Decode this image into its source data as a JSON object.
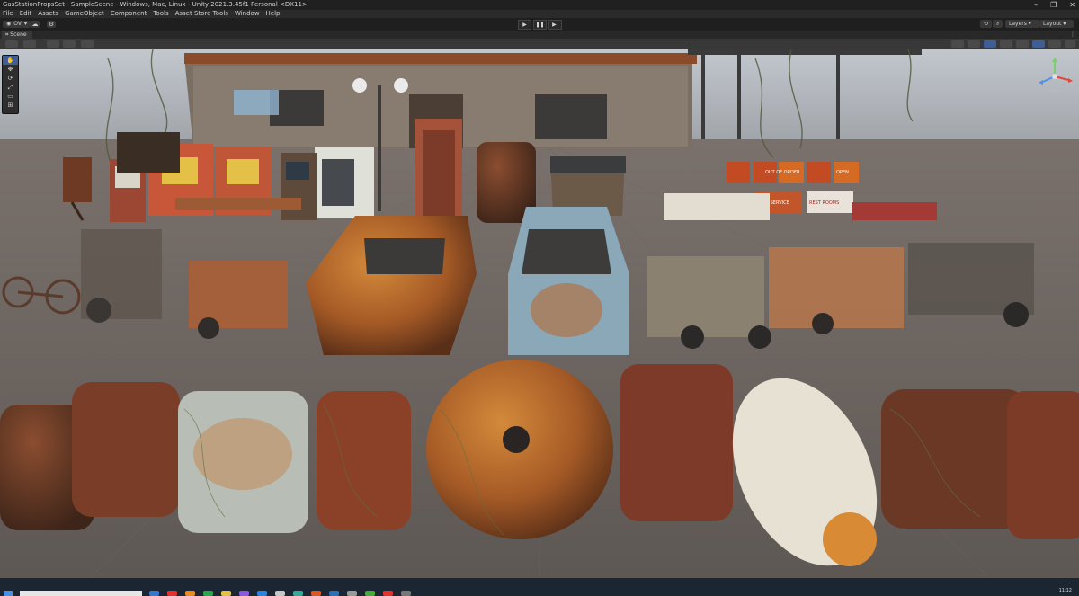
{
  "window": {
    "title": "GasStationPropsSet - SampleScene - Windows, Mac, Linux - Unity 2021.3.45f1 Personal <DX11>"
  },
  "menu": [
    "File",
    "Edit",
    "Assets",
    "GameObject",
    "Component",
    "Tools",
    "Asset Store Tools",
    "Window",
    "Help"
  ],
  "toolbar": {
    "account_label": "OV",
    "layers_label": "Layers",
    "layout_label": "Layout"
  },
  "scene_tab": {
    "label": "Scene"
  },
  "gizmo": {
    "label": "Persp"
  },
  "signs": {
    "out_of_order": "OUT OF ORDER",
    "full_service": "FULL SERVICE",
    "rest_rooms": "REST ROOMS",
    "open": "OPEN"
  },
  "taskbar": {
    "clock": "11:12"
  },
  "colors": {
    "sky": "#a8aeb6",
    "ground": "#77716c",
    "rust": "#9a4f27",
    "selection": "#3e5f96"
  }
}
